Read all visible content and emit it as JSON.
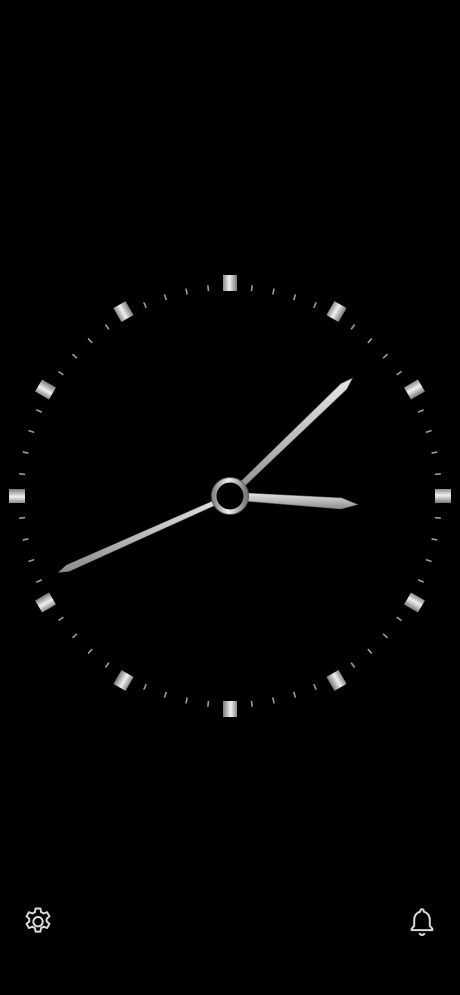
{
  "clock": {
    "hour": 3,
    "minute": 7,
    "second": 41,
    "colors": {
      "background": "#000000",
      "hand": "#c8c8c8",
      "hand_light": "#ececec",
      "hand_dark": "#8c8c8c",
      "tick": "#9a9a9a"
    }
  },
  "controls": {
    "settings_icon": "gear-icon",
    "alarm_icon": "bell-icon"
  }
}
